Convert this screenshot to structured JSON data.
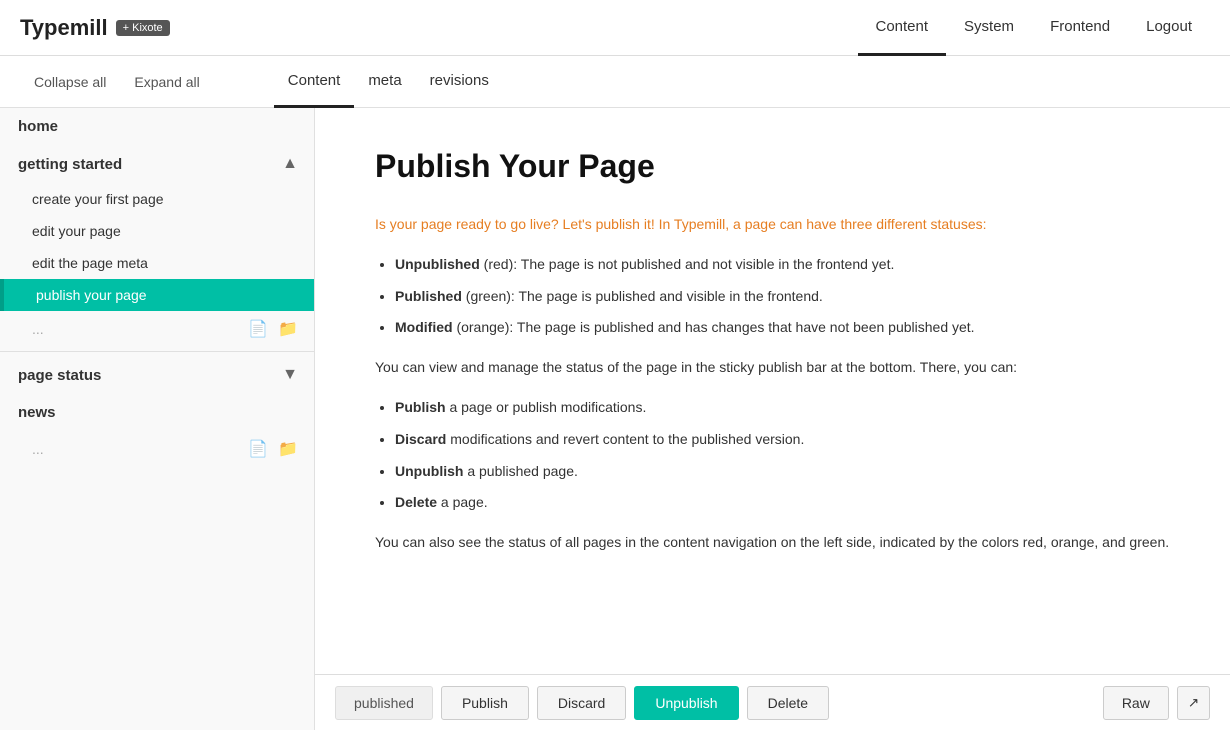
{
  "brand": {
    "title": "Typemill",
    "badge": "+ Kixote"
  },
  "top_nav": {
    "links": [
      {
        "label": "Content",
        "active": true
      },
      {
        "label": "System",
        "active": false
      },
      {
        "label": "Frontend",
        "active": false
      },
      {
        "label": "Logout",
        "active": false
      }
    ]
  },
  "sub_header": {
    "collapse_all": "Collapse all",
    "expand_all": "Expand all",
    "tabs": [
      {
        "label": "Content",
        "active": true
      },
      {
        "label": "meta",
        "active": false
      },
      {
        "label": "revisions",
        "active": false
      }
    ]
  },
  "sidebar": {
    "items": [
      {
        "label": "home",
        "type": "top-level"
      },
      {
        "label": "getting started",
        "type": "top-level",
        "expanded": true,
        "toggle": "▲"
      },
      {
        "label": "create your first page",
        "type": "child"
      },
      {
        "label": "edit your page",
        "type": "child"
      },
      {
        "label": "edit the page meta",
        "type": "child"
      },
      {
        "label": "publish your page",
        "type": "child",
        "active": true
      },
      {
        "label": "page status",
        "type": "top-level",
        "toggle": "▼"
      },
      {
        "label": "news",
        "type": "top-level"
      }
    ],
    "placeholder1": "...",
    "placeholder2": "..."
  },
  "content": {
    "title": "Publish Your Page",
    "intro": "Is your page ready to go live? Let's publish it! In Typemill, a page can have three different statuses:",
    "statuses": [
      {
        "term": "Unpublished",
        "note": "(red):",
        "desc": "The page is not published and not visible in the frontend yet."
      },
      {
        "term": "Published",
        "note": "(green):",
        "desc": "The page is published and visible in the frontend."
      },
      {
        "term": "Modified",
        "note": "(orange):",
        "desc": "The page is published and has changes that have not been published yet."
      }
    ],
    "manage_text": "You can view and manage the status of the page in the sticky publish bar at the bottom. There, you can:",
    "actions": [
      {
        "term": "Publish",
        "desc": "a page or publish modifications."
      },
      {
        "term": "Discard",
        "desc": "modifications and revert content to the published version."
      },
      {
        "term": "Unpublish",
        "desc": "a published page."
      },
      {
        "term": "Delete",
        "desc": "a page."
      }
    ],
    "footer_text": "You can also see the status of all pages in the content navigation on the left side, indicated by the colors red, orange, and green."
  },
  "publish_bar": {
    "status": "published",
    "publish_btn": "Publish",
    "discard_btn": "Discard",
    "unpublish_btn": "Unpublish",
    "delete_btn": "Delete",
    "raw_btn": "Raw",
    "ext_icon": "↗"
  }
}
